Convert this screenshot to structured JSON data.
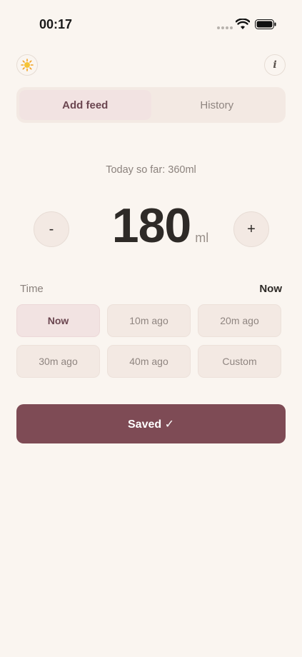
{
  "status_bar": {
    "time": "00:17"
  },
  "header": {
    "theme_icon": "sun-icon",
    "info_icon": "info-icon",
    "info_glyph": "i"
  },
  "tabs": [
    {
      "label": "Add feed",
      "active": true
    },
    {
      "label": "History",
      "active": false
    }
  ],
  "summary": {
    "today_text": "Today so far: 360ml"
  },
  "amount": {
    "value": "180",
    "unit": "ml",
    "decrement_label": "-",
    "increment_label": "+"
  },
  "time": {
    "label": "Time",
    "selected": "Now",
    "options": [
      {
        "label": "Now",
        "active": true
      },
      {
        "label": "10m ago",
        "active": false
      },
      {
        "label": "20m ago",
        "active": false
      },
      {
        "label": "30m ago",
        "active": false
      },
      {
        "label": "40m ago",
        "active": false
      },
      {
        "label": "Custom",
        "active": false
      }
    ]
  },
  "save_button": {
    "label": "Saved ✓"
  },
  "colors": {
    "background": "#faf5f0",
    "accent": "#7e4b55",
    "active_chip": "#f2e3e2",
    "chip": "#f3e9e3"
  }
}
